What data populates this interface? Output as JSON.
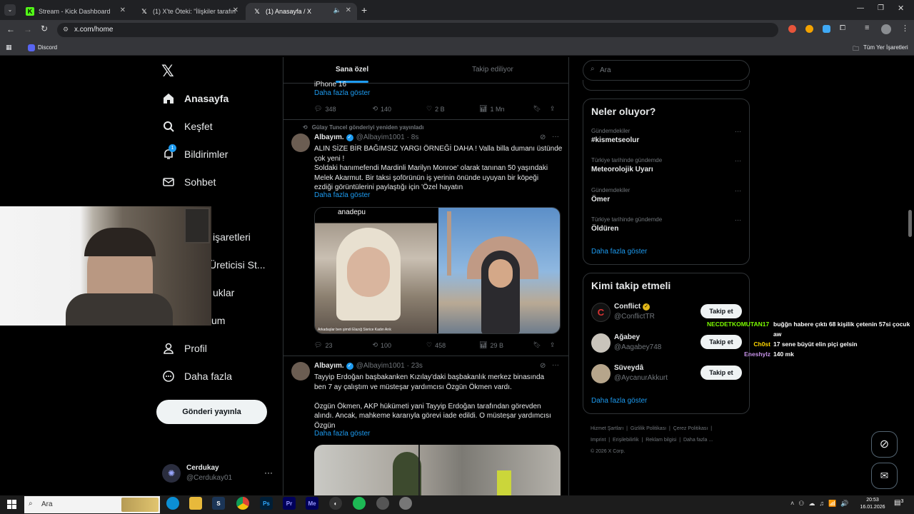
{
  "browser": {
    "tabs": [
      {
        "title": "Stream - Kick Dashboard",
        "icon": "kick-icon"
      },
      {
        "title": "(1) X'te Öteki: \"İlişkiler tarafından",
        "icon": "x-logo-icon"
      },
      {
        "title": "(1) Anasayfa / X",
        "icon": "x-logo-icon"
      }
    ],
    "address": "x.com/home",
    "bookmark": "Discord",
    "all_bookmarks": "Tüm Yer İşaretleri"
  },
  "nav": {
    "items": [
      "Anasayfa",
      "Keşfet",
      "Bildirimler",
      "Sohbet",
      "işaretleri",
      "Üreticisi St...",
      "uklar",
      "um",
      "Profil",
      "Daha fazla"
    ],
    "notif_badge": "1",
    "post_button": "Gönderi yayınla",
    "account_name": "Cerdukay",
    "account_handle": "@Cerdukay01"
  },
  "feed": {
    "tabs": [
      "Sana özel",
      "Takip ediliyor"
    ],
    "prev_tail": "iPhone 16",
    "show_more": "Daha fazla göster",
    "prev_actions": {
      "reply": "348",
      "repost": "140",
      "like": "2 B",
      "views": "1 Mn"
    },
    "repost_note": "Gülay Tuncel gönderiyi yeniden yayınladı",
    "tweet1": {
      "name": "Albayım.",
      "handle": "@Albayim1001",
      "time": "· 8s",
      "line1": "ALIN SİZE BİR BAĞIMSIZ YARGI ÖRNEĞİ DAHA ! Valla billa dumanı üstünde",
      "line2": "çok yeni !",
      "line3": "Soldaki hanımefendi Mardinli Marilyn Monroe' olarak tanınan 50 yaşındaki",
      "line4": "Melek Akarmut. Bir taksi şoförünün iş yerinin önünde uyuyan bir köpeği",
      "line5": "ezdiği görüntülerini paylaştığı için 'Özel hayatın",
      "img_caption_top": "anadepu",
      "img_caption_bottom": "Arkadaşlar ben şimdi Elazığ Sivrice Kadın Arık",
      "actions": {
        "reply": "23",
        "repost": "100",
        "like": "458",
        "views": "29 B"
      }
    },
    "tweet2": {
      "name": "Albayım.",
      "handle": "@Albayim1001",
      "time": "· 23s",
      "line1": "Tayyip Erdoğan başbakanken Kızılay'daki başbakanlık merkez binasında",
      "line2": "ben 7 ay çalıştım ve müsteşar yardımcısı Özgün Ökmen vardı.",
      "line3": "Özgün Ökmen, AKP hükümeti yani Tayyip Erdoğan tarafından görevden",
      "line4": "alındı. Ancak, mahkeme kararıyla görevi iade edildi. O müsteşar yardımcısı",
      "line5": "Özgün"
    }
  },
  "right": {
    "search_placeholder": "Ara",
    "trends_title": "Neler oluyor?",
    "trends": [
      {
        "context": "Gündemdekiler",
        "name": "#kismetseolur"
      },
      {
        "context": "Türkiye tarihinde gündemde",
        "name": "Meteorolojik Uyarı"
      },
      {
        "context": "Gündemdekiler",
        "name": "Ömer"
      },
      {
        "context": "Türkiye tarihinde gündemde",
        "name": "Öldüren"
      }
    ],
    "show_more": "Daha fazla göster",
    "follow_title": "Kimi takip etmeli",
    "follow": [
      {
        "name": "Conflict",
        "handle": "@ConflictTR"
      },
      {
        "name": "Ağabey",
        "handle": "@Aagabey748"
      },
      {
        "name": "Süveydâ",
        "handle": "@AycanurAkkurt"
      }
    ],
    "follow_btn": "Takip et",
    "footer1": [
      "Hizmet Şartları",
      "Gizlilik Politikası",
      "Çerez Politikası"
    ],
    "footer2": [
      "Imprint",
      "Erişilebilirlik",
      "Reklam bilgisi",
      "Daha fazla ..."
    ],
    "copyright": "© 2026 X Corp."
  },
  "chat": [
    {
      "user": "NECDETKOMUTAN17",
      "msg": "buğğn habere çıktı 68 kişilik çetenin 57si çocuk",
      "cont": "aw",
      "color": "#7cfc00"
    },
    {
      "user": "Ch0st",
      "msg": "17 sene büyüt elin piçi gelsin",
      "color": "#ffd700"
    },
    {
      "user": "Eneshylz",
      "msg": "140 mk",
      "color": "#c792ea"
    }
  ],
  "taskbar": {
    "search": "Ara",
    "time": "20:53",
    "date": "16.01.2026",
    "notif_count": "3"
  },
  "colors": {
    "accent": "#1d9bf0",
    "border": "#2f3336",
    "muted": "#71767b"
  }
}
